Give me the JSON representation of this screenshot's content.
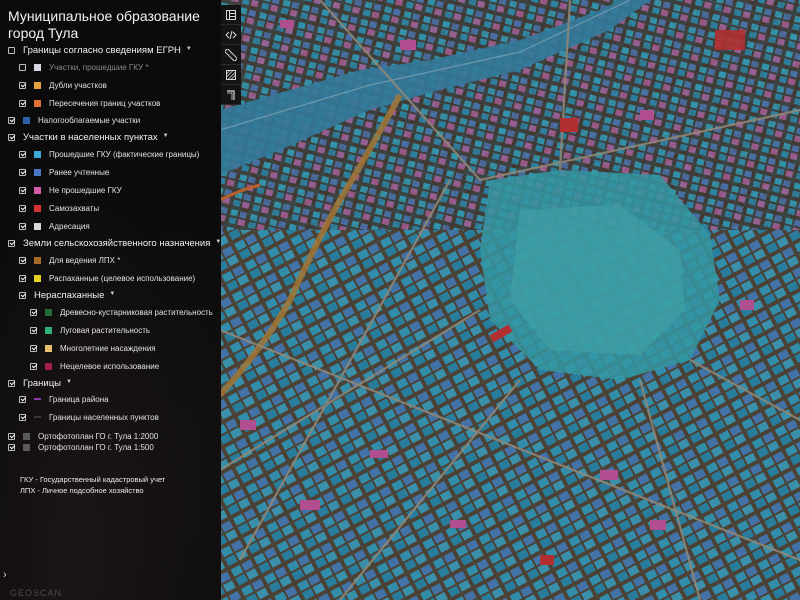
{
  "panel": {
    "title": "Муниципальное образование город Тула",
    "groups": [
      {
        "label": "Границы согласно сведениям ЕГРН",
        "checked": false,
        "items": [
          {
            "label": "Участки, прошедшие ГКУ *",
            "checked": false,
            "color": "#d6d6e6",
            "dim": true
          },
          {
            "label": "Дубли участков",
            "checked": true,
            "color": "#e8a13a"
          },
          {
            "label": "Пересечения границ участков",
            "checked": true,
            "color": "#e07030"
          }
        ]
      },
      {
        "label": "Налогооблагаемые участки",
        "checked": true,
        "color": "#2f5fa8"
      },
      {
        "label": "Участки в населенных пунктах",
        "checked": true,
        "items": [
          {
            "label": "Прошедшие ГКУ (фактические границы)",
            "checked": true,
            "color": "#39a9d8"
          },
          {
            "label": "Ранее учтенные",
            "checked": true,
            "color": "#4a78c8"
          },
          {
            "label": "Не прошедшие ГКУ",
            "checked": true,
            "color": "#d65aa8"
          },
          {
            "label": "Самозахваты",
            "checked": true,
            "color": "#d63434"
          },
          {
            "label": "Адресация",
            "checked": true,
            "color": "#d8d8d8"
          }
        ]
      },
      {
        "label": "Земли сельскохозяйственного назначения",
        "checked": true,
        "items": [
          {
            "label": "Для ведения ЛПХ *",
            "checked": true,
            "color": "#a86a2a"
          },
          {
            "label": "Распаханные (целевое использование)",
            "checked": true,
            "color": "#e8d020"
          }
        ]
      },
      {
        "label": "Нераспаханные",
        "checked": true,
        "items": [
          {
            "label": "Древесно-кустарниковая растительность",
            "checked": true,
            "color": "#1f6e3a"
          },
          {
            "label": "Луговая растительность",
            "checked": true,
            "color": "#2fb07a"
          },
          {
            "label": "Многолетние насаждения",
            "checked": true,
            "color": "#e8c070"
          },
          {
            "label": "Нецелевое использование",
            "checked": true,
            "color": "#a0204a"
          }
        ]
      },
      {
        "label": "Границы",
        "checked": true,
        "items": [
          {
            "label": "Граница района",
            "checked": true,
            "color": "#8a3aa8"
          },
          {
            "label": "Границы населенных пунктов",
            "checked": true,
            "color": "#1a1a1a"
          }
        ]
      }
    ],
    "orthophoto": [
      {
        "label": "Ортофотоплан ГО г. Тула 1:2000",
        "checked": true,
        "color": "#5a5a5a"
      },
      {
        "label": "Ортофотоплан ГО г. Тула 1:500",
        "checked": true,
        "color": "#5a5a5a"
      }
    ],
    "notes": [
      "ГКУ - Государственный кадастровый учет",
      "ЛПХ - Личное подсобное хозяйство"
    ],
    "expand_glyph": "›",
    "watermark": "GEOSCAN"
  },
  "toolbar": {
    "tools": [
      {
        "name": "layers-toggle-icon"
      },
      {
        "name": "embed-code-icon"
      },
      {
        "name": "ruler-icon"
      },
      {
        "name": "hatch-area-icon"
      },
      {
        "name": "corner-angle-icon"
      }
    ]
  },
  "colors": {
    "map_base": "#2a3b40",
    "parcel_cyan": "#39a9d8",
    "parcel_blue": "#4a78c8",
    "parcel_pink": "#d65aa8",
    "parcel_red": "#d63434",
    "boundary_orange": "#e07030"
  }
}
